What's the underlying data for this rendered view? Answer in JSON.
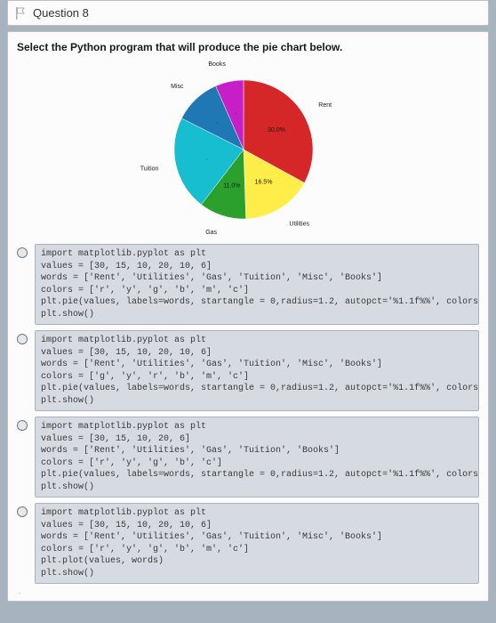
{
  "header": {
    "question_label": "Question 8",
    "flag_icon_name": "flag-icon"
  },
  "prompt": "Select the Python program that will produce the pie chart below.",
  "chart_data": {
    "type": "pie",
    "title": "",
    "categories": [
      "Rent",
      "Utilities",
      "Gas",
      "Tuition",
      "Misc",
      "Books"
    ],
    "values": [
      30,
      15,
      10,
      20,
      10,
      6
    ],
    "colors": [
      "#d62728",
      "#ffed4a",
      "#2ca02c",
      "#17becf",
      "#1f77b4",
      "#c71fc7"
    ],
    "percent_labels": [
      "30.0%",
      "16.5%",
      "11.0%",
      ".",
      ".",
      "."
    ],
    "startangle": 0,
    "autopct": "%1.1f%%",
    "radius": 1.2
  },
  "options": [
    {
      "id": "opt-a",
      "lines": [
        "import matplotlib.pyplot as plt",
        "values = [30, 15, 10, 20, 10, 6]",
        "words = ['Rent', 'Utilities', 'Gas', 'Tuition', 'Misc', 'Books']",
        "colors = ['r', 'y', 'g', 'b', 'm', 'c']",
        "plt.pie(values, labels=words, startangle = 0,radius=1.2, autopct='%1.1f%%', colors=colors)",
        "plt.show()"
      ]
    },
    {
      "id": "opt-b",
      "lines": [
        "import matplotlib.pyplot as plt",
        "values = [30, 15, 10, 20, 10, 6]",
        "words = ['Rent', 'Utilities', 'Gas', 'Tuition', 'Misc', 'Books']",
        "colors = ['g', 'y', 'r', 'b', 'm', 'c']",
        "plt.pie(values, labels=words, startangle = 0,radius=1.2, autopct='%1.1f%%', colors=colors)",
        "plt.show()"
      ]
    },
    {
      "id": "opt-c",
      "lines": [
        "import matplotlib.pyplot as plt",
        "values = [30, 15, 10, 20, 6]",
        "words = ['Rent', 'Utilities', 'Gas', 'Tuition', 'Books']",
        "colors = ['r', 'y', 'g', 'b', 'c']",
        "plt.pie(values, labels=words, startangle = 0,radius=1.2, autopct='%1.1f%%', colors=colors)",
        "plt.show()"
      ]
    },
    {
      "id": "opt-d",
      "lines": [
        "import matplotlib.pyplot as plt",
        "values = [30, 15, 10, 20, 10, 6]",
        "words = ['Rent', 'Utilities', 'Gas', 'Tuition', 'Misc', 'Books']",
        "colors = ['r', 'y', 'g', 'b', 'm', 'c']",
        "plt.plot(values, words)",
        "plt.show()"
      ]
    }
  ],
  "footnote": "."
}
